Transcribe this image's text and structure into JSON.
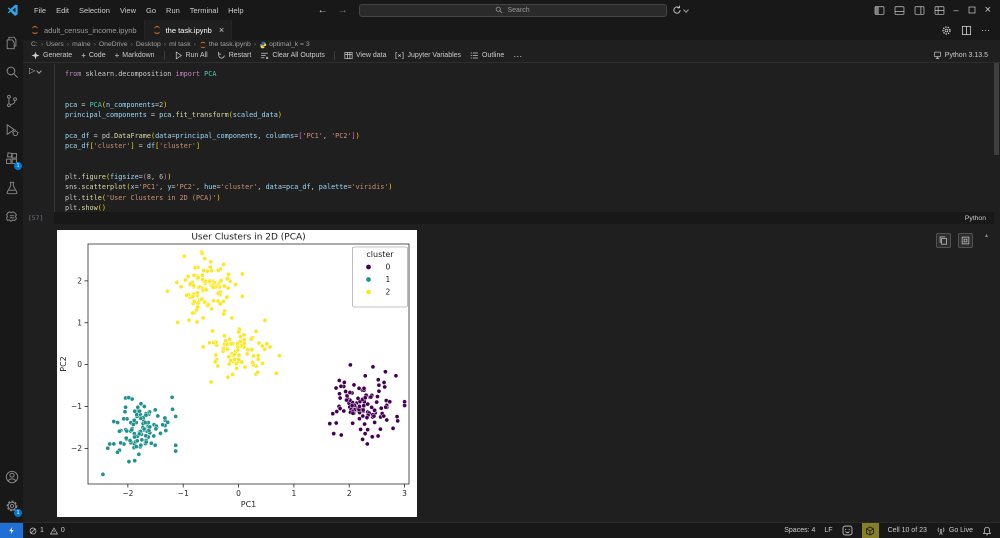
{
  "window": {
    "menus": [
      "File",
      "Edit",
      "Selection",
      "View",
      "Go",
      "Run",
      "Terminal",
      "Help"
    ],
    "search_placeholder": "Search",
    "controls": {
      "minimize": "–",
      "close": "×"
    },
    "nav": {
      "back": "←",
      "forward": "→"
    }
  },
  "activity_bar": {
    "top": [
      "explorer",
      "search",
      "source-control",
      "run-and-debug",
      "extensions",
      "testing",
      "data-extension"
    ],
    "bottom": [
      "account",
      "settings"
    ],
    "extensions_badge": "1",
    "settings_badge": "1"
  },
  "tabs": [
    {
      "label": "adult_census_income.ipynb",
      "active": false
    },
    {
      "label": "the task.ipynb",
      "active": true,
      "close": "×"
    }
  ],
  "breadcrumb": [
    "C:",
    "Users",
    "malne",
    "OneDrive",
    "Desktop",
    "ml task",
    "the task.ipynb",
    "optimal_k = 3"
  ],
  "toolbar": {
    "items": [
      "Generate",
      "Code",
      "Markdown",
      "Run All",
      "Restart",
      "Clear All Outputs",
      "View data",
      "Jupyter Variables",
      "Outline",
      "···"
    ],
    "kernel": "Python 3.13.5"
  },
  "cell": {
    "execution_count": "[57]",
    "language": "Python",
    "run_glyph": "▷",
    "code_lines": [
      [
        [
          "from",
          "kw"
        ],
        [
          " sklearn.decomposition",
          "plain"
        ],
        [
          " import",
          "kw"
        ],
        [
          " PCA",
          "type"
        ]
      ],
      [],
      [],
      [
        [
          "pca",
          "var"
        ],
        [
          " = ",
          "plain"
        ],
        [
          "PCA",
          "type"
        ],
        [
          "(",
          "b1"
        ],
        [
          "n_components",
          "var"
        ],
        [
          "=",
          "plain"
        ],
        [
          "2",
          "num"
        ],
        [
          ")",
          "b1"
        ]
      ],
      [
        [
          "principal_components",
          "var"
        ],
        [
          " = ",
          "plain"
        ],
        [
          "pca",
          "var"
        ],
        [
          ".",
          "plain"
        ],
        [
          "fit_transform",
          "func"
        ],
        [
          "(",
          "b1"
        ],
        [
          "scaled_data",
          "var"
        ],
        [
          ")",
          "b1"
        ]
      ],
      [],
      [
        [
          "pca_df",
          "var"
        ],
        [
          " = ",
          "plain"
        ],
        [
          "pd",
          "plain"
        ],
        [
          ".",
          "plain"
        ],
        [
          "DataFrame",
          "func"
        ],
        [
          "(",
          "b1"
        ],
        [
          "data",
          "var"
        ],
        [
          "=",
          "plain"
        ],
        [
          "principal_components",
          "var"
        ],
        [
          ", ",
          "plain"
        ],
        [
          "columns",
          "var"
        ],
        [
          "=",
          "plain"
        ],
        [
          "[",
          "b2"
        ],
        [
          "'PC1'",
          "str"
        ],
        [
          ", ",
          "plain"
        ],
        [
          "'PC2'",
          "str"
        ],
        [
          "]",
          "b2"
        ],
        [
          ")",
          "b1"
        ]
      ],
      [
        [
          "pca_df",
          "var"
        ],
        [
          "[",
          "b1"
        ],
        [
          "'cluster'",
          "str"
        ],
        [
          "]",
          "b1"
        ],
        [
          " = ",
          "plain"
        ],
        [
          "df",
          "var"
        ],
        [
          "[",
          "b1"
        ],
        [
          "'cluster'",
          "str"
        ],
        [
          "]",
          "b1"
        ]
      ],
      [],
      [],
      [
        [
          "plt",
          "plain"
        ],
        [
          ".",
          "plain"
        ],
        [
          "figure",
          "func"
        ],
        [
          "(",
          "b1"
        ],
        [
          "figsize",
          "var"
        ],
        [
          "=",
          "plain"
        ],
        [
          "(",
          "b2"
        ],
        [
          "8",
          "num"
        ],
        [
          ", ",
          "plain"
        ],
        [
          "6",
          "num"
        ],
        [
          ")",
          "b2"
        ],
        [
          ")",
          "b1"
        ]
      ],
      [
        [
          "sns",
          "plain"
        ],
        [
          ".",
          "plain"
        ],
        [
          "scatterplot",
          "func"
        ],
        [
          "(",
          "b1"
        ],
        [
          "x",
          "var"
        ],
        [
          "=",
          "plain"
        ],
        [
          "'PC1'",
          "str"
        ],
        [
          ", ",
          "plain"
        ],
        [
          "y",
          "var"
        ],
        [
          "=",
          "plain"
        ],
        [
          "'PC2'",
          "str"
        ],
        [
          ", ",
          "plain"
        ],
        [
          "hue",
          "var"
        ],
        [
          "=",
          "plain"
        ],
        [
          "'cluster'",
          "str"
        ],
        [
          ", ",
          "plain"
        ],
        [
          "data",
          "var"
        ],
        [
          "=",
          "plain"
        ],
        [
          "pca_df",
          "var"
        ],
        [
          ", ",
          "plain"
        ],
        [
          "palette",
          "var"
        ],
        [
          "=",
          "plain"
        ],
        [
          "'viridis'",
          "str"
        ],
        [
          ")",
          "b1"
        ]
      ],
      [
        [
          "plt",
          "plain"
        ],
        [
          ".",
          "plain"
        ],
        [
          "title",
          "func"
        ],
        [
          "(",
          "b1"
        ],
        [
          "'User Clusters in 2D (PCA)'",
          "str"
        ],
        [
          ")",
          "b1"
        ]
      ],
      [
        [
          "plt",
          "plain"
        ],
        [
          ".",
          "plain"
        ],
        [
          "show",
          "func"
        ],
        [
          "(",
          "b1"
        ],
        [
          ")",
          "b1"
        ]
      ]
    ]
  },
  "chart_data": {
    "type": "scatter",
    "title": "User Clusters in 2D (PCA)",
    "xlabel": "PC1",
    "ylabel": "PC2",
    "xlim": [
      -2.72,
      3.08
    ],
    "ylim": [
      -2.85,
      2.88
    ],
    "xticks": [
      -2,
      -1,
      0,
      1,
      2,
      3
    ],
    "yticks": [
      -2,
      -1,
      0,
      1,
      2
    ],
    "grid": false,
    "legend": {
      "title": "cluster",
      "position": "upper-right",
      "entries": [
        {
          "label": "0",
          "color": "#440154"
        },
        {
          "label": "1",
          "color": "#21918c"
        },
        {
          "label": "2",
          "color": "#fde725"
        }
      ]
    },
    "clusters": [
      {
        "label": "0",
        "color": "#440154",
        "center": [
          2.28,
          -0.95
        ],
        "std": [
          0.3,
          0.37
        ],
        "count": 115,
        "seed": 7
      },
      {
        "label": "1",
        "color": "#21918c",
        "center": [
          -1.85,
          -1.5
        ],
        "std": [
          0.28,
          0.32
        ],
        "count": 110,
        "seed": 13,
        "extra_points": [
          [
            -2.45,
            -2.62
          ],
          [
            -1.2,
            -0.78
          ]
        ]
      },
      {
        "label": "2",
        "color": "#fde725",
        "center": [
          -0.62,
          1.85
        ],
        "std": [
          0.27,
          0.33
        ],
        "count": 105,
        "seed": 29
      },
      {
        "label": "2",
        "color": "#fde725",
        "center": [
          0.05,
          0.35
        ],
        "std": [
          0.27,
          0.3
        ],
        "count": 85,
        "seed": 41
      }
    ]
  },
  "status_bar": {
    "errors": "1",
    "warnings": "0",
    "spaces": "Spaces: 4",
    "eol": "LF",
    "cell_indicator": "Cell 10 of 23",
    "go_live": "Go Live"
  }
}
